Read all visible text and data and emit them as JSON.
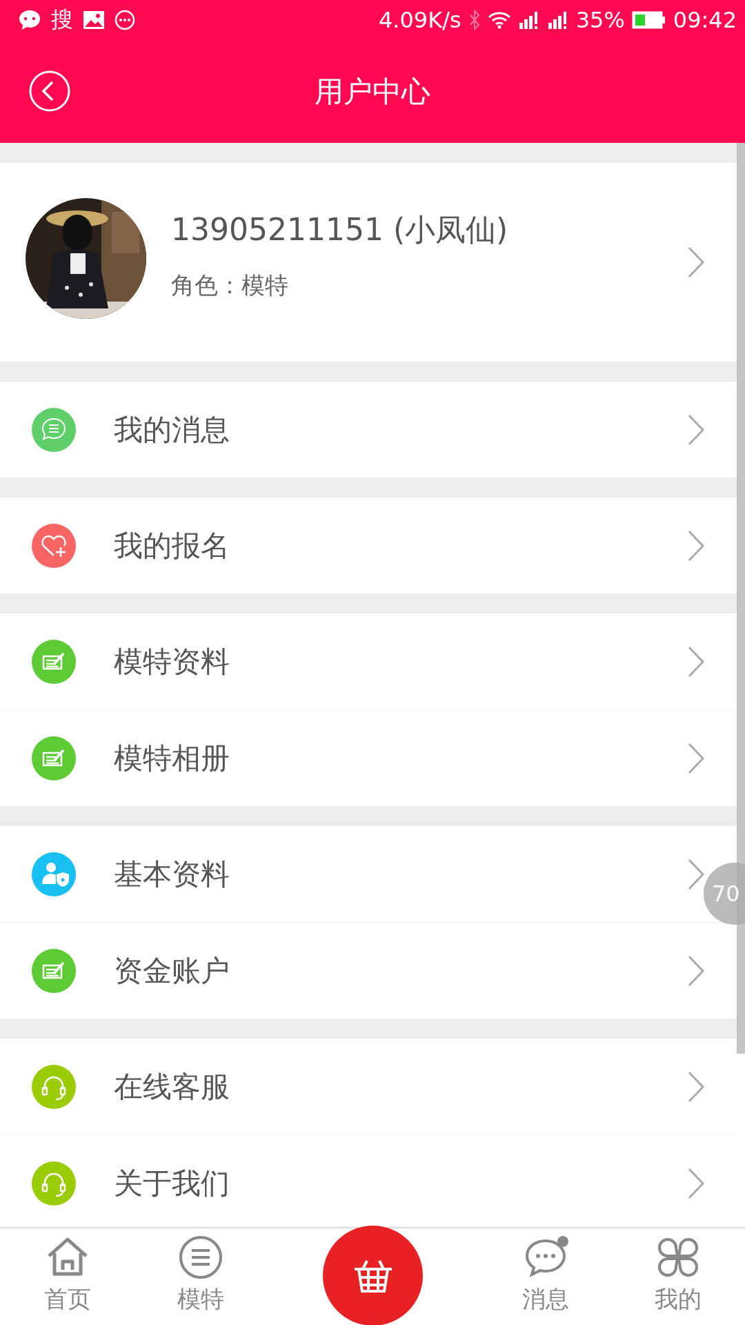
{
  "status_bar": {
    "left_text": "搜",
    "speed": "4.09K/s",
    "battery_percent": "35%",
    "time": "09:42"
  },
  "header": {
    "title": "用户中心"
  },
  "profile": {
    "name": "13905211151 (小凤仙)",
    "role": "角色：模特"
  },
  "sections": [
    [
      {
        "label": "我的消息",
        "kind": "chat",
        "color": "#5fcf6a"
      }
    ],
    [
      {
        "label": "我的报名",
        "kind": "heart",
        "color": "#f76464"
      }
    ],
    [
      {
        "label": "模特资料",
        "kind": "edit",
        "color": "#5ccb34"
      },
      {
        "label": "模特相册",
        "kind": "edit",
        "color": "#5ccb34"
      }
    ],
    [
      {
        "label": "基本资料",
        "kind": "user",
        "color": "#18c0f2"
      },
      {
        "label": "资金账户",
        "kind": "edit",
        "color": "#5ccb34"
      }
    ],
    [
      {
        "label": "在线客服",
        "kind": "headset",
        "color": "#9acd08"
      },
      {
        "label": "关于我们",
        "kind": "headset",
        "color": "#9acd08"
      }
    ]
  ],
  "floating_badge": "70",
  "bottom_nav": [
    {
      "label": "首页",
      "kind": "home"
    },
    {
      "label": "模特",
      "kind": "list"
    },
    {
      "kind": "center"
    },
    {
      "label": "消息",
      "kind": "chat"
    },
    {
      "label": "我的",
      "kind": "clover"
    }
  ]
}
